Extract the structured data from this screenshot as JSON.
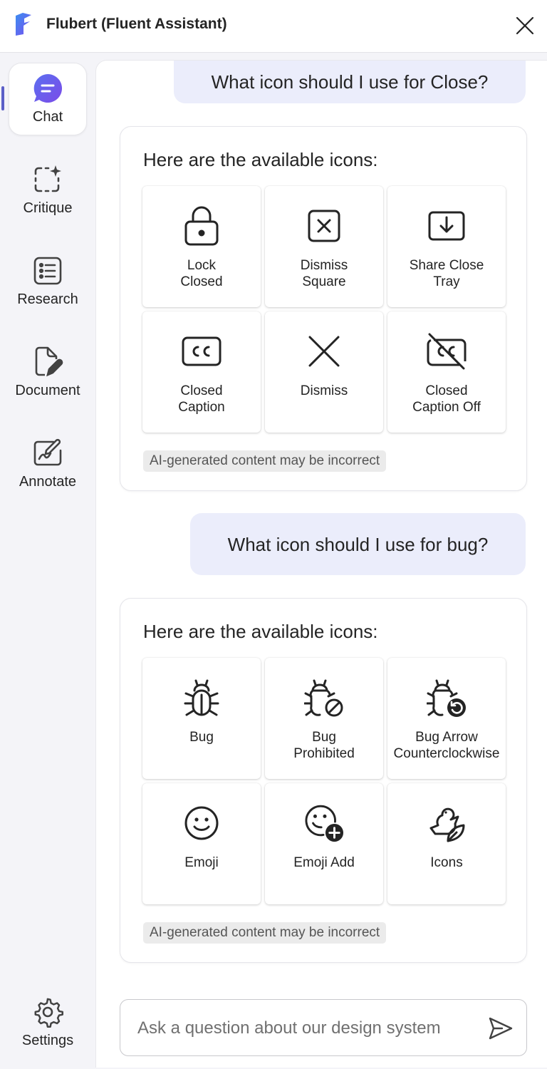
{
  "app": {
    "title": "Flubert (Fluent Assistant)",
    "accent_color": "#5b5fc7",
    "logo_icon": "fluent-logo",
    "close_icon": "close-icon"
  },
  "sidebar": {
    "items": [
      {
        "label": "Chat",
        "icon": "chat-icon",
        "active": true
      },
      {
        "label": "Critique",
        "icon": "sparkle-select-icon",
        "active": false
      },
      {
        "label": "Research",
        "icon": "list-icon",
        "active": false
      },
      {
        "label": "Document",
        "icon": "document-edit-icon",
        "active": false
      },
      {
        "label": "Annotate",
        "icon": "annotate-icon",
        "active": false
      }
    ],
    "settings": {
      "label": "Settings",
      "icon": "settings-icon"
    }
  },
  "conversation": {
    "q1": "What icon should I use for Close?",
    "a1": {
      "heading": "Here are the available icons:",
      "icons": [
        {
          "label": "Lock\nClosed",
          "icon": "lock-closed-icon"
        },
        {
          "label": "Dismiss\nSquare",
          "icon": "dismiss-square-icon"
        },
        {
          "label": "Share Close\nTray",
          "icon": "share-close-tray-icon"
        },
        {
          "label": "Closed\nCaption",
          "icon": "closed-caption-icon"
        },
        {
          "label": "Dismiss",
          "icon": "dismiss-icon"
        },
        {
          "label": "Closed\nCaption Off",
          "icon": "closed-caption-off-icon"
        }
      ],
      "disclaimer": "AI-generated content may be incorrect"
    },
    "q2": "What icon should I use for bug?",
    "a2": {
      "heading": "Here are the available icons:",
      "icons": [
        {
          "label": "Bug",
          "icon": "bug-icon"
        },
        {
          "label": "Bug\nProhibited",
          "icon": "bug-prohibited-icon"
        },
        {
          "label": "Bug Arrow\nCounterclockwise",
          "icon": "bug-arrow-counterclockwise-icon"
        },
        {
          "label": "Emoji",
          "icon": "emoji-icon"
        },
        {
          "label": "Emoji Add",
          "icon": "emoji-add-icon"
        },
        {
          "label": "Icons",
          "icon": "icons-icon"
        }
      ],
      "disclaimer": "AI-generated content may be incorrect"
    }
  },
  "input": {
    "placeholder": "Ask a question about our design system",
    "value": "",
    "send_icon": "send-icon"
  }
}
